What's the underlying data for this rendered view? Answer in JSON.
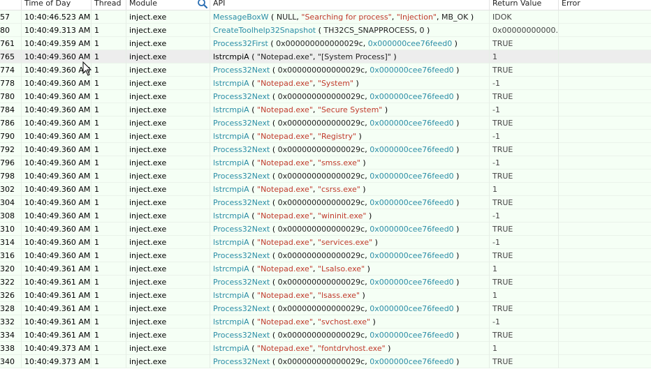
{
  "columns": {
    "time": "Time of Day",
    "thread": "Thread",
    "module": "Module",
    "api": "API",
    "ret": "Return Value",
    "error": "Error"
  },
  "rows": [
    {
      "idx": "57",
      "time": "10:40:46.523 AM",
      "thread": "1",
      "module": "inject.exe",
      "fn": "MessageBoxW",
      "a1": "NULL",
      "a1t": "arg",
      "a2": "\"Searching for process\"",
      "a2t": "str",
      "a3": "\"Injection\"",
      "a3t": "str",
      "a4": "MB_OK",
      "ret": "IDOK"
    },
    {
      "idx": "80",
      "time": "10:40:49.313 AM",
      "thread": "1",
      "module": "inject.exe",
      "fn": "CreateToolhelp32Snapshot",
      "a1": "TH32CS_SNAPPROCESS",
      "a1t": "arg",
      "a2": "0",
      "a2t": "arg",
      "ret": "0x00000000000..."
    },
    {
      "idx": "761",
      "time": "10:40:49.359 AM",
      "thread": "1",
      "module": "inject.exe",
      "fn": "Process32First",
      "a1": "0x000000000000029c",
      "a1t": "arg",
      "a2": "0x000000cee76feed0",
      "a2t": "hex",
      "ret": "TRUE"
    },
    {
      "idx": "765",
      "time": "10:40:49.360 AM",
      "thread": "1",
      "module": "inject.exe",
      "fn": "lstrcmpiA",
      "a1": "\"Notepad.exe\"",
      "a1t": "arg",
      "a2": "\"[System Process]\"",
      "a2t": "arg",
      "ret": "1",
      "selected": true
    },
    {
      "idx": "774",
      "time": "10:40:49.360 AM",
      "thread": "1",
      "module": "inject.exe",
      "fn": "Process32Next",
      "a1": "0x000000000000029c",
      "a1t": "arg",
      "a2": "0x000000cee76feed0",
      "a2t": "hex",
      "ret": "TRUE"
    },
    {
      "idx": "778",
      "time": "10:40:49.360 AM",
      "thread": "1",
      "module": "inject.exe",
      "fn": "lstrcmpiA",
      "a1": "\"Notepad.exe\"",
      "a1t": "str",
      "a2": "\"System\"",
      "a2t": "str",
      "ret": "-1"
    },
    {
      "idx": "780",
      "time": "10:40:49.360 AM",
      "thread": "1",
      "module": "inject.exe",
      "fn": "Process32Next",
      "a1": "0x000000000000029c",
      "a1t": "arg",
      "a2": "0x000000cee76feed0",
      "a2t": "hex",
      "ret": "TRUE"
    },
    {
      "idx": "784",
      "time": "10:40:49.360 AM",
      "thread": "1",
      "module": "inject.exe",
      "fn": "lstrcmpiA",
      "a1": "\"Notepad.exe\"",
      "a1t": "str",
      "a2": "\"Secure System\"",
      "a2t": "str",
      "ret": "-1"
    },
    {
      "idx": "786",
      "time": "10:40:49.360 AM",
      "thread": "1",
      "module": "inject.exe",
      "fn": "Process32Next",
      "a1": "0x000000000000029c",
      "a1t": "arg",
      "a2": "0x000000cee76feed0",
      "a2t": "hex",
      "ret": "TRUE"
    },
    {
      "idx": "790",
      "time": "10:40:49.360 AM",
      "thread": "1",
      "module": "inject.exe",
      "fn": "lstrcmpiA",
      "a1": "\"Notepad.exe\"",
      "a1t": "str",
      "a2": "\"Registry\"",
      "a2t": "str",
      "ret": "-1"
    },
    {
      "idx": "792",
      "time": "10:40:49.360 AM",
      "thread": "1",
      "module": "inject.exe",
      "fn": "Process32Next",
      "a1": "0x000000000000029c",
      "a1t": "arg",
      "a2": "0x000000cee76feed0",
      "a2t": "hex",
      "ret": "TRUE"
    },
    {
      "idx": "796",
      "time": "10:40:49.360 AM",
      "thread": "1",
      "module": "inject.exe",
      "fn": "lstrcmpiA",
      "a1": "\"Notepad.exe\"",
      "a1t": "str",
      "a2": "\"smss.exe\"",
      "a2t": "str",
      "ret": "-1"
    },
    {
      "idx": "798",
      "time": "10:40:49.360 AM",
      "thread": "1",
      "module": "inject.exe",
      "fn": "Process32Next",
      "a1": "0x000000000000029c",
      "a1t": "arg",
      "a2": "0x000000cee76feed0",
      "a2t": "hex",
      "ret": "TRUE"
    },
    {
      "idx": "302",
      "time": "10:40:49.360 AM",
      "thread": "1",
      "module": "inject.exe",
      "fn": "lstrcmpiA",
      "a1": "\"Notepad.exe\"",
      "a1t": "str",
      "a2": "\"csrss.exe\"",
      "a2t": "str",
      "ret": "1"
    },
    {
      "idx": "304",
      "time": "10:40:49.360 AM",
      "thread": "1",
      "module": "inject.exe",
      "fn": "Process32Next",
      "a1": "0x000000000000029c",
      "a1t": "arg",
      "a2": "0x000000cee76feed0",
      "a2t": "hex",
      "ret": "TRUE"
    },
    {
      "idx": "308",
      "time": "10:40:49.360 AM",
      "thread": "1",
      "module": "inject.exe",
      "fn": "lstrcmpiA",
      "a1": "\"Notepad.exe\"",
      "a1t": "str",
      "a2": "\"wininit.exe\"",
      "a2t": "str",
      "ret": "-1"
    },
    {
      "idx": "310",
      "time": "10:40:49.360 AM",
      "thread": "1",
      "module": "inject.exe",
      "fn": "Process32Next",
      "a1": "0x000000000000029c",
      "a1t": "arg",
      "a2": "0x000000cee76feed0",
      "a2t": "hex",
      "ret": "TRUE"
    },
    {
      "idx": "314",
      "time": "10:40:49.360 AM",
      "thread": "1",
      "module": "inject.exe",
      "fn": "lstrcmpiA",
      "a1": "\"Notepad.exe\"",
      "a1t": "str",
      "a2": "\"services.exe\"",
      "a2t": "str",
      "ret": "-1"
    },
    {
      "idx": "316",
      "time": "10:40:49.360 AM",
      "thread": "1",
      "module": "inject.exe",
      "fn": "Process32Next",
      "a1": "0x000000000000029c",
      "a1t": "arg",
      "a2": "0x000000cee76feed0",
      "a2t": "hex",
      "ret": "TRUE"
    },
    {
      "idx": "320",
      "time": "10:40:49.361 AM",
      "thread": "1",
      "module": "inject.exe",
      "fn": "lstrcmpiA",
      "a1": "\"Notepad.exe\"",
      "a1t": "str",
      "a2": "\"LsaIso.exe\"",
      "a2t": "str",
      "ret": "1"
    },
    {
      "idx": "322",
      "time": "10:40:49.361 AM",
      "thread": "1",
      "module": "inject.exe",
      "fn": "Process32Next",
      "a1": "0x000000000000029c",
      "a1t": "arg",
      "a2": "0x000000cee76feed0",
      "a2t": "hex",
      "ret": "TRUE"
    },
    {
      "idx": "326",
      "time": "10:40:49.361 AM",
      "thread": "1",
      "module": "inject.exe",
      "fn": "lstrcmpiA",
      "a1": "\"Notepad.exe\"",
      "a1t": "str",
      "a2": "\"lsass.exe\"",
      "a2t": "str",
      "ret": "1"
    },
    {
      "idx": "328",
      "time": "10:40:49.361 AM",
      "thread": "1",
      "module": "inject.exe",
      "fn": "Process32Next",
      "a1": "0x000000000000029c",
      "a1t": "arg",
      "a2": "0x000000cee76feed0",
      "a2t": "hex",
      "ret": "TRUE"
    },
    {
      "idx": "332",
      "time": "10:40:49.361 AM",
      "thread": "1",
      "module": "inject.exe",
      "fn": "lstrcmpiA",
      "a1": "\"Notepad.exe\"",
      "a1t": "str",
      "a2": "\"svchost.exe\"",
      "a2t": "str",
      "ret": "-1"
    },
    {
      "idx": "334",
      "time": "10:40:49.361 AM",
      "thread": "1",
      "module": "inject.exe",
      "fn": "Process32Next",
      "a1": "0x000000000000029c",
      "a1t": "arg",
      "a2": "0x000000cee76feed0",
      "a2t": "hex",
      "ret": "TRUE"
    },
    {
      "idx": "338",
      "time": "10:40:49.373 AM",
      "thread": "1",
      "module": "inject.exe",
      "fn": "lstrcmpiA",
      "a1": "\"Notepad.exe\"",
      "a1t": "str",
      "a2": "\"fontdrvhost.exe\"",
      "a2t": "str",
      "ret": "1"
    },
    {
      "idx": "340",
      "time": "10:40:49.373 AM",
      "thread": "1",
      "module": "inject.exe",
      "fn": "Process32Next",
      "a1": "0x000000000000029c",
      "a1t": "arg",
      "a2": "0x000000cee76feed0",
      "a2t": "hex",
      "ret": "TRUE"
    }
  ]
}
